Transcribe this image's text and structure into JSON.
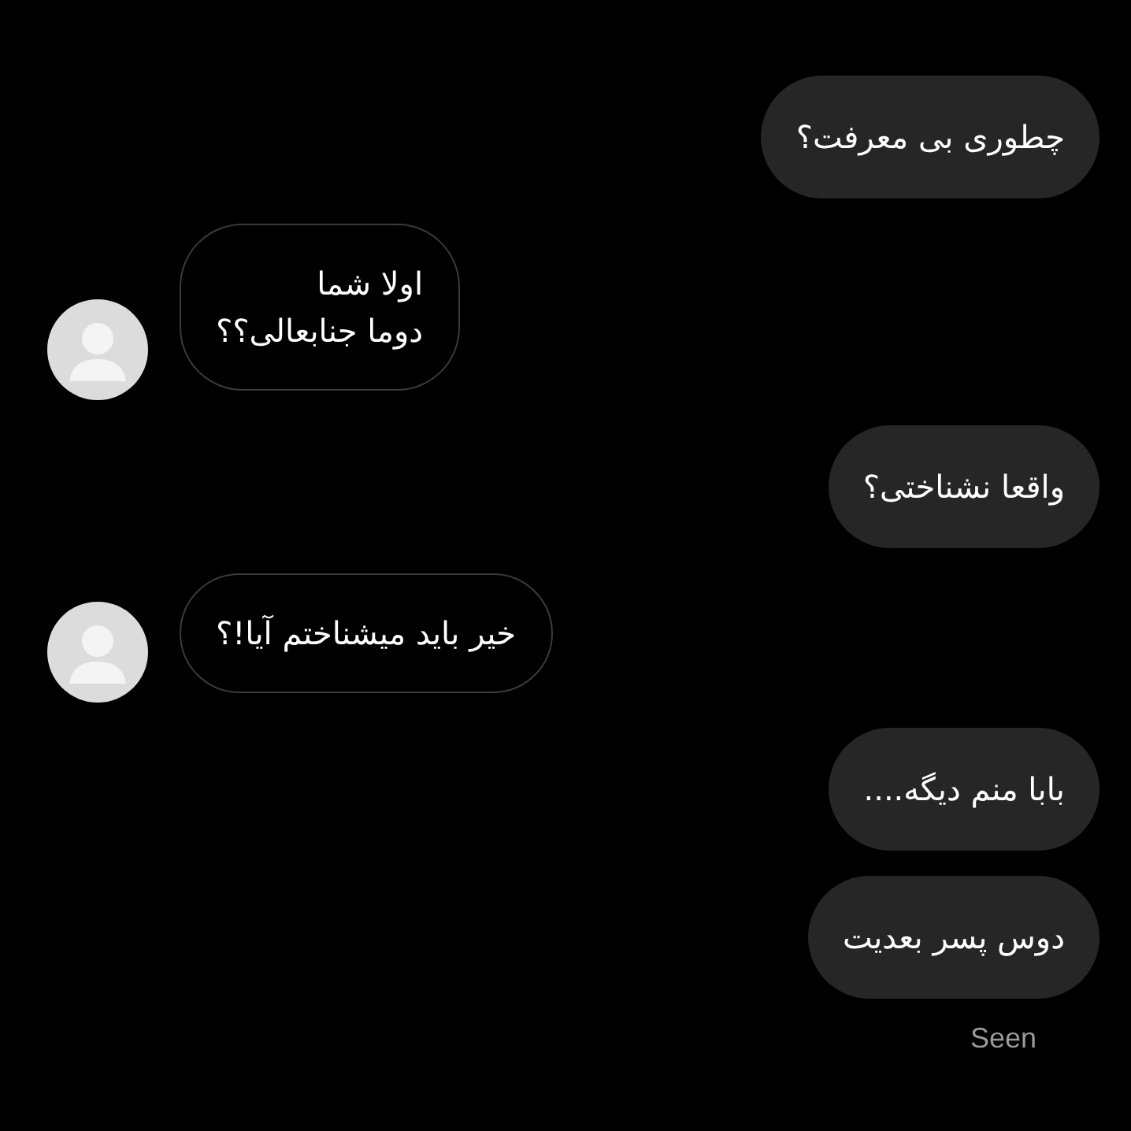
{
  "messages": [
    {
      "kind": "outgoing",
      "text": "چطوری بی معرفت؟"
    },
    {
      "kind": "incoming",
      "text": "اولا شما\nدوما جنابعالی؟؟"
    },
    {
      "kind": "outgoing",
      "text": "واقعا نشناختی؟"
    },
    {
      "kind": "incoming",
      "text": "خیر باید میشناختم آیا!؟"
    },
    {
      "kind": "outgoing",
      "text": "بابا منم دیگه...."
    },
    {
      "kind": "outgoing",
      "text": "دوس پسر بعدیت"
    }
  ],
  "status": "Seen"
}
